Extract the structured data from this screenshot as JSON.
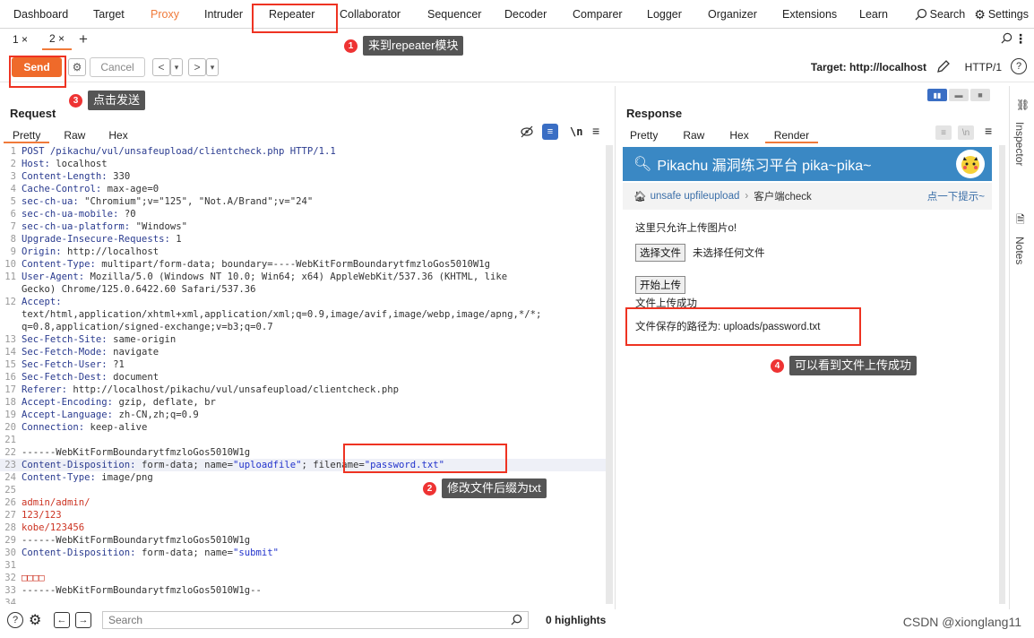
{
  "topnav": {
    "tabs": [
      "Dashboard",
      "Target",
      "Proxy",
      "Intruder",
      "Repeater",
      "Collaborator",
      "Sequencer",
      "Decoder",
      "Comparer",
      "Logger",
      "Organizer",
      "Extensions",
      "Learn"
    ],
    "search_label": "Search",
    "settings_label": "Settings"
  },
  "subtabs": {
    "items": [
      "1 ×",
      "2 ×"
    ],
    "plus": "+"
  },
  "toolbar": {
    "send_label": "Send",
    "cancel_label": "Cancel",
    "target_label": "Target: http://localhost",
    "http_version": "HTTP/1"
  },
  "annotations": {
    "a1": {
      "num": "1",
      "text": "来到repeater模块"
    },
    "a2": {
      "num": "2",
      "text": "修改文件后缀为txt"
    },
    "a3": {
      "num": "3",
      "text": "点击发送"
    },
    "a4": {
      "num": "4",
      "text": "可以看到文件上传成功"
    }
  },
  "request": {
    "title": "Request",
    "tabs": [
      "Pretty",
      "Raw",
      "Hex"
    ],
    "newline_toggle": "\\n",
    "lines": [
      {
        "n": "1",
        "parts": [
          [
            "hdr",
            "POST /pikachu/vul/unsafeupload/clientcheck.php HTTP/1.1"
          ]
        ]
      },
      {
        "n": "2",
        "parts": [
          [
            "hdr",
            "Host: "
          ],
          [
            "val",
            "localhost"
          ]
        ]
      },
      {
        "n": "3",
        "parts": [
          [
            "hdr",
            "Content-Length: "
          ],
          [
            "val",
            "330"
          ]
        ]
      },
      {
        "n": "4",
        "parts": [
          [
            "hdr",
            "Cache-Control: "
          ],
          [
            "val",
            "max-age=0"
          ]
        ]
      },
      {
        "n": "5",
        "parts": [
          [
            "hdr",
            "sec-ch-ua: "
          ],
          [
            "val",
            "\"Chromium\";v=\"125\", \"Not.A/Brand\";v=\"24\""
          ]
        ]
      },
      {
        "n": "6",
        "parts": [
          [
            "hdr",
            "sec-ch-ua-mobile: "
          ],
          [
            "val",
            "?0"
          ]
        ]
      },
      {
        "n": "7",
        "parts": [
          [
            "hdr",
            "sec-ch-ua-platform: "
          ],
          [
            "val",
            "\"Windows\""
          ]
        ]
      },
      {
        "n": "8",
        "parts": [
          [
            "hdr",
            "Upgrade-Insecure-Requests: "
          ],
          [
            "val",
            "1"
          ]
        ]
      },
      {
        "n": "9",
        "parts": [
          [
            "hdr",
            "Origin: "
          ],
          [
            "val",
            "http://localhost"
          ]
        ]
      },
      {
        "n": "10",
        "parts": [
          [
            "hdr",
            "Content-Type: "
          ],
          [
            "val",
            "multipart/form-data; boundary=----WebKitFormBoundarytfmzloGos5010W1g"
          ]
        ]
      },
      {
        "n": "11",
        "parts": [
          [
            "hdr",
            "User-Agent: "
          ],
          [
            "val",
            "Mozilla/5.0 (Windows NT 10.0; Win64; x64) AppleWebKit/537.36 (KHTML, like"
          ]
        ]
      },
      {
        "n": "",
        "parts": [
          [
            "val",
            "Gecko) Chrome/125.0.6422.60 Safari/537.36"
          ]
        ]
      },
      {
        "n": "12",
        "parts": [
          [
            "hdr",
            "Accept:"
          ]
        ]
      },
      {
        "n": "",
        "parts": [
          [
            "val",
            "text/html,application/xhtml+xml,application/xml;q=0.9,image/avif,image/webp,image/apng,*/*;"
          ]
        ]
      },
      {
        "n": "",
        "parts": [
          [
            "val",
            "q=0.8,application/signed-exchange;v=b3;q=0.7"
          ]
        ]
      },
      {
        "n": "13",
        "parts": [
          [
            "hdr",
            "Sec-Fetch-Site: "
          ],
          [
            "val",
            "same-origin"
          ]
        ]
      },
      {
        "n": "14",
        "parts": [
          [
            "hdr",
            "Sec-Fetch-Mode: "
          ],
          [
            "val",
            "navigate"
          ]
        ]
      },
      {
        "n": "15",
        "parts": [
          [
            "hdr",
            "Sec-Fetch-User: "
          ],
          [
            "val",
            "?1"
          ]
        ]
      },
      {
        "n": "16",
        "parts": [
          [
            "hdr",
            "Sec-Fetch-Dest: "
          ],
          [
            "val",
            "document"
          ]
        ]
      },
      {
        "n": "17",
        "parts": [
          [
            "hdr",
            "Referer: "
          ],
          [
            "val",
            "http://localhost/pikachu/vul/unsafeupload/clientcheck.php"
          ]
        ]
      },
      {
        "n": "18",
        "parts": [
          [
            "hdr",
            "Accept-Encoding: "
          ],
          [
            "val",
            "gzip, deflate, br"
          ]
        ]
      },
      {
        "n": "19",
        "parts": [
          [
            "hdr",
            "Accept-Language: "
          ],
          [
            "val",
            "zh-CN,zh;q=0.9"
          ]
        ]
      },
      {
        "n": "20",
        "parts": [
          [
            "hdr",
            "Connection: "
          ],
          [
            "val",
            "keep-alive"
          ]
        ]
      },
      {
        "n": "21",
        "parts": [
          [
            "val",
            ""
          ]
        ]
      },
      {
        "n": "22",
        "parts": [
          [
            "val",
            "------WebKitFormBoundarytfmzloGos5010W1g"
          ]
        ]
      },
      {
        "n": "23",
        "hl": true,
        "parts": [
          [
            "hdr",
            "Content-Disposition: "
          ],
          [
            "val",
            "form-data; name="
          ],
          [
            "str",
            "\"uploadfile\""
          ],
          [
            "val",
            "; filename="
          ],
          [
            "str",
            "\"password.txt\""
          ]
        ]
      },
      {
        "n": "24",
        "parts": [
          [
            "hdr",
            "Content-Type: "
          ],
          [
            "val",
            "image/png"
          ]
        ]
      },
      {
        "n": "25",
        "parts": [
          [
            "val",
            ""
          ]
        ]
      },
      {
        "n": "26",
        "parts": [
          [
            "red",
            "admin/admin/"
          ]
        ]
      },
      {
        "n": "27",
        "parts": [
          [
            "red",
            "123/123"
          ]
        ]
      },
      {
        "n": "28",
        "parts": [
          [
            "red",
            "kobe/123456"
          ]
        ]
      },
      {
        "n": "29",
        "parts": [
          [
            "val",
            "------WebKitFormBoundarytfmzloGos5010W1g"
          ]
        ]
      },
      {
        "n": "30",
        "parts": [
          [
            "hdr",
            "Content-Disposition: "
          ],
          [
            "val",
            "form-data; name="
          ],
          [
            "str",
            "\"submit\""
          ]
        ]
      },
      {
        "n": "31",
        "parts": [
          [
            "val",
            ""
          ]
        ]
      },
      {
        "n": "32",
        "parts": [
          [
            "red",
            "□□□□"
          ]
        ]
      },
      {
        "n": "33",
        "parts": [
          [
            "val",
            "------WebKitFormBoundarytfmzloGos5010W1g--"
          ]
        ]
      },
      {
        "n": "34",
        "parts": [
          [
            "val",
            ""
          ]
        ]
      }
    ]
  },
  "bottom": {
    "search_placeholder": "Search",
    "highlights": "0 highlights"
  },
  "response": {
    "title": "Response",
    "tabs": [
      "Pretty",
      "Raw",
      "Hex",
      "Render"
    ],
    "page": {
      "header": "Pikachu 漏洞练习平台 pika~pika~",
      "crumb_link": "unsafe upfileupload",
      "crumb_sep": "›",
      "crumb_current": "客户端check",
      "crumb_right": "点一下提示~",
      "hint": "这里只允许上传图片o!",
      "choose_file": "选择文件",
      "no_file": "未选择任何文件",
      "upload_btn": "开始上传",
      "success": "文件上传成功",
      "saved_path": "文件保存的路径为: uploads/password.txt"
    }
  },
  "rail": {
    "inspector": "Inspector",
    "notes": "Notes"
  },
  "watermark": "CSDN @xionglang11"
}
